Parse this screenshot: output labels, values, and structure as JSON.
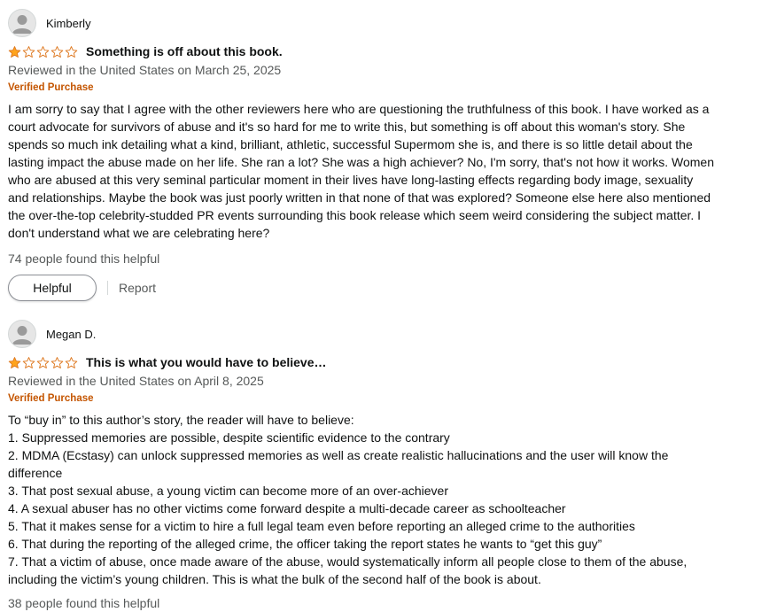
{
  "colors": {
    "star": "#ffa41c",
    "verified": "#c45500",
    "meta": "#565959"
  },
  "reviews": [
    {
      "name": "Kimberly",
      "rating": 1,
      "title": "Something is off about this book.",
      "meta": "Reviewed in the United States on March 25, 2025",
      "verified": "Verified Purchase",
      "body": "I am sorry to say that I agree with the other reviewers here who are questioning the truthfulness of this book. I have worked as a court advocate for survivors of abuse and it's so hard for me to write this, but something is off about this woman's story. She spends so much ink detailing what a kind, brilliant, athletic, successful Supermom she is, and there is so little detail about the lasting impact the abuse made on her life. She ran a lot? She was a high achiever? No, I'm sorry, that's not how it works. Women who are abused at this very seminal particular moment in their lives have long-lasting effects regarding body image, sexuality and relationships. Maybe the book was just poorly written in that none of that was explored? Someone else here also mentioned the over-the-top celebrity-studded PR events surrounding this book release which seem weird considering the subject matter. I don't understand what we are celebrating here?",
      "helpful_count": "74 people found this helpful",
      "helpful_label": "Helpful",
      "report_label": "Report"
    },
    {
      "name": "Megan D.",
      "rating": 1,
      "title": "This is what you would have to believe…",
      "meta": "Reviewed in the United States on April 8, 2025",
      "verified": "Verified Purchase",
      "body_lines": [
        "To “buy in” to this author’s story, the reader will have to believe:",
        "1. Suppressed memories are possible, despite scientific evidence to the contrary",
        "2. MDMA (Ecstasy) can unlock suppressed memories as well as create realistic hallucinations and the user will know the difference",
        "3. That post sexual abuse, a young victim can become more of an over-achiever",
        "4. A sexual abuser has no other victims come forward despite a multi-decade career as schoolteacher",
        "5. That it makes sense for a victim to hire a full legal team even before reporting an alleged crime to the authorities",
        "6. That during the reporting of the alleged crime, the officer taking the report states he wants to “get this guy”",
        "7. That a victim of abuse, once made aware of the abuse, would systematically inform all people close to them of the abuse, including the victim’s young children. This is what the bulk of the second half of the book is about."
      ],
      "helpful_count": "38 people found this helpful"
    }
  ]
}
